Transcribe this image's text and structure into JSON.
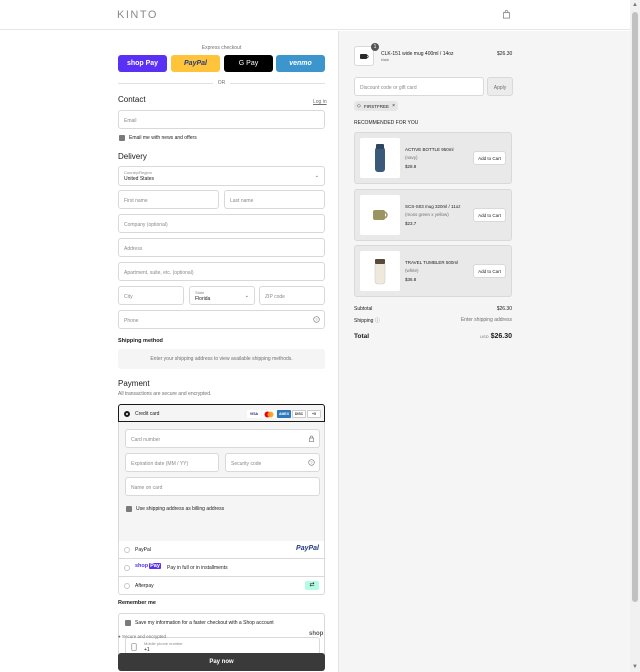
{
  "header": {
    "logo": "KINTO",
    "cart_icon": "shopping-bag-icon"
  },
  "express": {
    "title": "Express checkout",
    "buttons": [
      {
        "label": "shop Pay",
        "color": "#5a31f4"
      },
      {
        "label": "PayPal",
        "color": "#ffc439"
      },
      {
        "label": "G Pay",
        "color": "#000000"
      },
      {
        "label": "venmo",
        "color": "#3d95ce"
      }
    ],
    "or": "OR"
  },
  "contact": {
    "heading": "Contact",
    "login": "Log in",
    "email_placeholder": "Email",
    "news_label": "Email me with news and offers"
  },
  "delivery": {
    "heading": "Delivery",
    "country_label": "Country/Region",
    "country_value": "United States",
    "first_name": "First name",
    "last_name": "Last name",
    "company": "Company (optional)",
    "address": "Address",
    "apartment": "Apartment, suite, etc. (optional)",
    "city": "City",
    "state_label": "State",
    "state_value": "Florida",
    "zip": "ZIP code",
    "phone": "Phone"
  },
  "shipping": {
    "heading": "Shipping method",
    "message": "Enter your shipping address to view available shipping methods."
  },
  "payment": {
    "heading": "Payment",
    "subtitle": "All transactions are secure and encrypted.",
    "credit_card": "Credit card",
    "card_badges": [
      "VISA",
      "MC",
      "AMEX",
      "DISC",
      "+5"
    ],
    "card_number": "Card number",
    "expiration": "Expiration date (MM / YY)",
    "security": "Security code",
    "name_on_card": "Name on card",
    "billing_label": "Use shipping address as billing address",
    "paypal": "PayPal",
    "shoppay_text": "Pay in full or in installments",
    "afterpay": "Afterpay"
  },
  "remember": {
    "heading": "Remember me",
    "save_label": "Save my information for a faster checkout with a Shop account",
    "mobile_label": "Mobile phone number",
    "mobile_value": "+1"
  },
  "secure": {
    "text": "Secure and encrypted",
    "brand": "shop"
  },
  "pay_now": "Pay now",
  "summary": {
    "item": {
      "name": "CLK-151 wide mug 400ml / 14oz",
      "variant": "black",
      "qty": "1",
      "price": "$26.30"
    },
    "discount_placeholder": "Discount code or gift card",
    "apply": "Apply",
    "code": "FIRSTFREE",
    "rec_title": "RECOMMENDED FOR YOU",
    "recommendations": [
      {
        "name": "ACTIVE BOTTLE 950ml",
        "variant": "(navy)",
        "price": "$28.8",
        "add": "Add to Cart"
      },
      {
        "name": "SCS-S03 mug 320ml / 11oz",
        "variant": "(moss green x yellow)",
        "price": "$23.7",
        "add": "Add to Cart"
      },
      {
        "name": "TRAVEL TUMBLER 500ml",
        "variant": "(white)",
        "price": "$36.8",
        "add": "Add to Cart"
      }
    ],
    "subtotal_label": "Subtotal",
    "subtotal_value": "$26.30",
    "shipping_label": "Shipping",
    "shipping_value": "Enter shipping address",
    "total_label": "Total",
    "currency": "USD",
    "total_value": "$26.30"
  }
}
